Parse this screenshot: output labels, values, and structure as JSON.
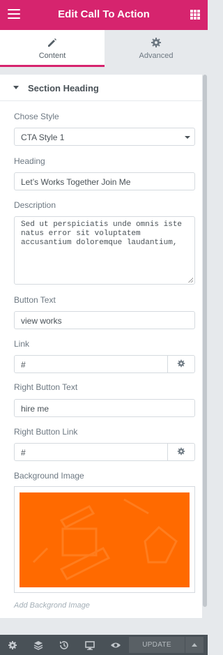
{
  "header": {
    "title": "Edit Call To Action",
    "menu_icon": "hamburger-icon",
    "apps_icon": "grid-icon",
    "bg_color": "#d6246e"
  },
  "tabs": [
    {
      "label": "Content",
      "icon": "pencil-icon",
      "active": true
    },
    {
      "label": "Advanced",
      "icon": "gear-icon",
      "active": false
    }
  ],
  "section": {
    "title": "Section Heading"
  },
  "fields": {
    "style_label": "Chose Style",
    "style_value": "CTA Style 1",
    "heading_label": "Heading",
    "heading_value": "Let’s Works Together Join Me",
    "description_label": "Description",
    "description_value": "Sed ut perspiciatis unde omnis iste natus error sit voluptatem accusantium doloremque laudantium,",
    "button_text_label": "Button Text",
    "button_text_value": "view works",
    "link_label": "Link",
    "link_value": "#",
    "right_button_text_label": "Right Button Text",
    "right_button_text_value": "hire me",
    "right_button_link_label": "Right Button Link",
    "right_button_link_value": "#",
    "bg_image_label": "Background Image",
    "bg_image_hint": "Add Backgrond Image",
    "bg_image_color": "#ff6a00"
  },
  "footer": {
    "update_label": "UPDATE",
    "icons": [
      "settings-icon",
      "layers-icon",
      "history-icon",
      "responsive-icon",
      "preview-icon"
    ]
  }
}
